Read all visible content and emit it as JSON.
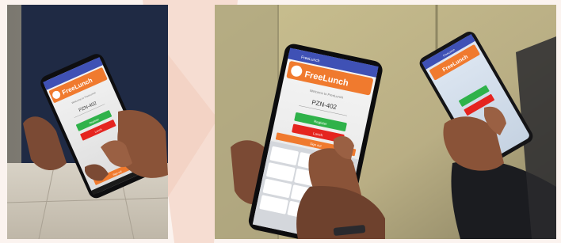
{
  "photos": [
    {
      "app_brand": "FreeLunch",
      "status_bar_title": "FreeLunch",
      "prompt": "Welcome to FreeLunch",
      "code": "PZN-402",
      "primary_button": "Register",
      "secondary_button": "Lunch",
      "footer_button": "Sign out"
    },
    {
      "app_brand": "FreeLunch",
      "status_bar_title": "FreeLunch",
      "prompt": "Welcome to FreeLunch",
      "code": "PZN-402",
      "primary_button": "Register",
      "secondary_button": "Lunch",
      "footer_button": "Sign out"
    }
  ],
  "colors": {
    "brand_orange": "#f07a2e",
    "button_green": "#2fb24a",
    "button_red": "#e5241f",
    "status_blue": "#3f51b5"
  }
}
